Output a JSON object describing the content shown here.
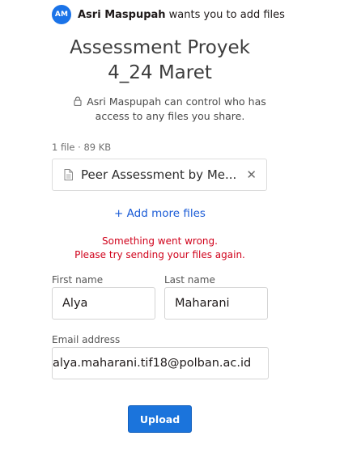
{
  "header": {
    "avatar_initials": "AM",
    "sender_name": "Asri Maspupah",
    "message_suffix": " wants you to add files"
  },
  "request": {
    "title_line1": "Assessment Proyek",
    "title_line2": "4_24 Maret"
  },
  "privacy_note": "Asri Maspupah can control who has access to any files you share.",
  "files": {
    "summary": "1 file · 89 KB",
    "items": [
      {
        "name": "Peer Assessment by Me..."
      }
    ]
  },
  "add_more_label": "+ Add more files",
  "error": {
    "line1": "Something went wrong.",
    "line2": "Please try sending your files again."
  },
  "form": {
    "first_name_label": "First name",
    "first_name_value": "Alya",
    "last_name_label": "Last name",
    "last_name_value": "Maharani",
    "email_label": "Email address",
    "email_value": "alya.maharani.tif18@polban.ac.id"
  },
  "upload_label": "Upload",
  "colors": {
    "accent": "#1b74dc",
    "link": "#1a5bd6",
    "error": "#d0021b"
  }
}
